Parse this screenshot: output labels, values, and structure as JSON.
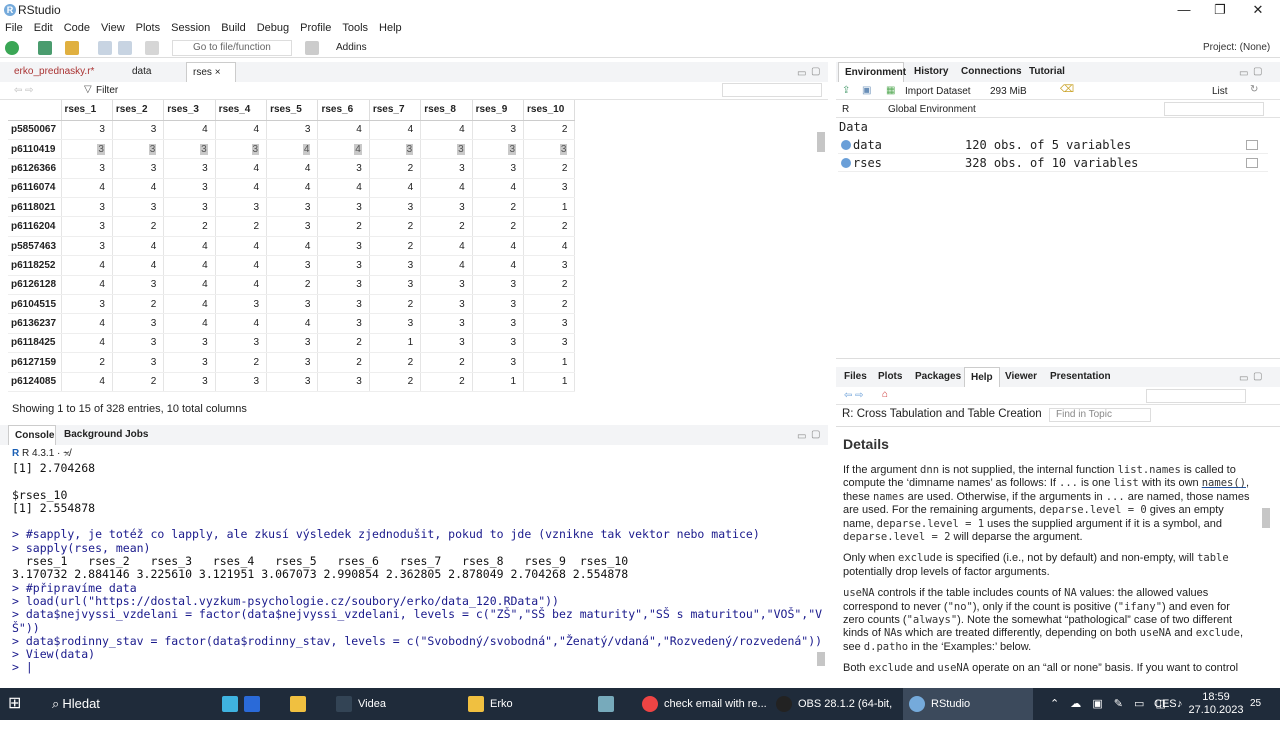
{
  "window": {
    "title": "RStudio",
    "minimize": "—",
    "maximize": "❐",
    "close": "✕"
  },
  "menu": [
    "File",
    "Edit",
    "Code",
    "View",
    "Plots",
    "Session",
    "Build",
    "Debug",
    "Profile",
    "Tools",
    "Help"
  ],
  "toolbar": {
    "goto_placeholder": "Go to file/function",
    "addins": "Addins",
    "project": "Project: (None)"
  },
  "source": {
    "tabs": [
      "erko_prednasky.r*",
      "data",
      "rses"
    ],
    "filter_label": "Filter",
    "columns": [
      "rses_1",
      "rses_2",
      "rses_3",
      "rses_4",
      "rses_5",
      "rses_6",
      "rses_7",
      "rses_8",
      "rses_9",
      "rses_10"
    ],
    "rows": [
      {
        "id": "p5850067",
        "v": [
          "3",
          "3",
          "4",
          "4",
          "3",
          "4",
          "4",
          "4",
          "3",
          "2"
        ]
      },
      {
        "id": "p6110419",
        "v": [
          "3",
          "3",
          "3",
          "3",
          "4",
          "4",
          "3",
          "3",
          "3",
          "3"
        ]
      },
      {
        "id": "p6126366",
        "v": [
          "3",
          "3",
          "3",
          "4",
          "4",
          "3",
          "2",
          "3",
          "3",
          "2"
        ]
      },
      {
        "id": "p6116074",
        "v": [
          "4",
          "4",
          "3",
          "4",
          "4",
          "4",
          "4",
          "4",
          "4",
          "3"
        ]
      },
      {
        "id": "p6118021",
        "v": [
          "3",
          "3",
          "3",
          "3",
          "3",
          "3",
          "3",
          "3",
          "2",
          "1"
        ]
      },
      {
        "id": "p6116204",
        "v": [
          "3",
          "2",
          "2",
          "2",
          "3",
          "2",
          "2",
          "2",
          "2",
          "2"
        ]
      },
      {
        "id": "p5857463",
        "v": [
          "3",
          "4",
          "4",
          "4",
          "4",
          "3",
          "2",
          "4",
          "4",
          "4"
        ]
      },
      {
        "id": "p6118252",
        "v": [
          "4",
          "4",
          "4",
          "4",
          "3",
          "3",
          "3",
          "4",
          "4",
          "3"
        ]
      },
      {
        "id": "p6126128",
        "v": [
          "4",
          "3",
          "4",
          "4",
          "2",
          "3",
          "3",
          "3",
          "3",
          "2"
        ]
      },
      {
        "id": "p6104515",
        "v": [
          "3",
          "2",
          "4",
          "3",
          "3",
          "3",
          "2",
          "3",
          "3",
          "2"
        ]
      },
      {
        "id": "p6136237",
        "v": [
          "4",
          "3",
          "4",
          "4",
          "4",
          "3",
          "3",
          "3",
          "3",
          "3"
        ]
      },
      {
        "id": "p6118425",
        "v": [
          "4",
          "3",
          "3",
          "3",
          "3",
          "2",
          "1",
          "3",
          "3",
          "3"
        ]
      },
      {
        "id": "p6127159",
        "v": [
          "2",
          "3",
          "3",
          "2",
          "3",
          "2",
          "2",
          "2",
          "3",
          "1"
        ]
      },
      {
        "id": "p6124085",
        "v": [
          "4",
          "2",
          "3",
          "3",
          "3",
          "3",
          "2",
          "2",
          "1",
          "1"
        ]
      }
    ],
    "status": "Showing 1 to 15 of 328 entries, 10 total columns"
  },
  "console": {
    "tabs": [
      "Console",
      "Background Jobs"
    ],
    "version": "R 4.3.1 · ~/",
    "lines": [
      {
        "t": "out",
        "s": "[1] 2.704268"
      },
      {
        "t": "out",
        "s": ""
      },
      {
        "t": "out",
        "s": "$rses_10"
      },
      {
        "t": "out",
        "s": "[1] 2.554878"
      },
      {
        "t": "out",
        "s": ""
      },
      {
        "t": "in",
        "s": "> #sapply, je totéž co lapply, ale zkusí výsledek zjednodušit, pokud to jde (vznikne tak vektor nebo matice)"
      },
      {
        "t": "in",
        "s": "> sapply(rses, mean)"
      },
      {
        "t": "out",
        "s": "  rses_1   rses_2   rses_3   rses_4   rses_5   rses_6   rses_7   rses_8   rses_9  rses_10 "
      },
      {
        "t": "out",
        "s": "3.170732 2.884146 3.225610 3.121951 3.067073 2.990854 2.362805 2.878049 2.704268 2.554878 "
      },
      {
        "t": "in",
        "s": "> #připravíme data"
      },
      {
        "t": "in",
        "s": "> load(url(\"https://dostal.vyzkum-psychologie.cz/soubory/erko/data_120.RData\"))"
      },
      {
        "t": "in",
        "s": "> data$nejvyssi_vzdelani = factor(data$nejvyssi_vzdelani, levels = c(\"ZŠ\",\"SŠ bez maturity\",\"SŠ s maturitou\",\"VOŠ\",\"V"
      },
      {
        "t": "in",
        "s": "Š\"))"
      },
      {
        "t": "in",
        "s": "> data$rodinny_stav = factor(data$rodinny_stav, levels = c(\"Svobodný/svobodná\",\"Ženatý/vdaná\",\"Rozvedený/rozvedená\"))"
      },
      {
        "t": "in",
        "s": "> View(data)"
      },
      {
        "t": "in",
        "s": "> |"
      }
    ]
  },
  "environment": {
    "tabs": [
      "Environment",
      "History",
      "Connections",
      "Tutorial"
    ],
    "import": "Import Dataset",
    "memory": "293 MiB",
    "view_mode": "List",
    "lang": "R",
    "scope": "Global Environment",
    "section": "Data",
    "items": [
      {
        "name": "data",
        "desc": "120 obs. of 5 variables"
      },
      {
        "name": "rses",
        "desc": "328 obs. of 10 variables"
      }
    ]
  },
  "help": {
    "tabs": [
      "Files",
      "Plots",
      "Packages",
      "Help",
      "Viewer",
      "Presentation"
    ],
    "topic": "R: Cross Tabulation and Table Creation",
    "find_placeholder": "Find in Topic",
    "heading": "Details"
  },
  "taskbar": {
    "search": "Hledat",
    "items": [
      "Videa",
      "Erko",
      "check email with re...",
      "OBS 28.1.2 (64-bit, ...",
      "RStudio"
    ],
    "lang": "CES",
    "time": "18:59",
    "date": "27.10.2023",
    "notif": "25"
  },
  "colors": {
    "accent": "#75aadb",
    "console_input": "#1a1a8c",
    "taskbar": "#1f2b3a"
  }
}
